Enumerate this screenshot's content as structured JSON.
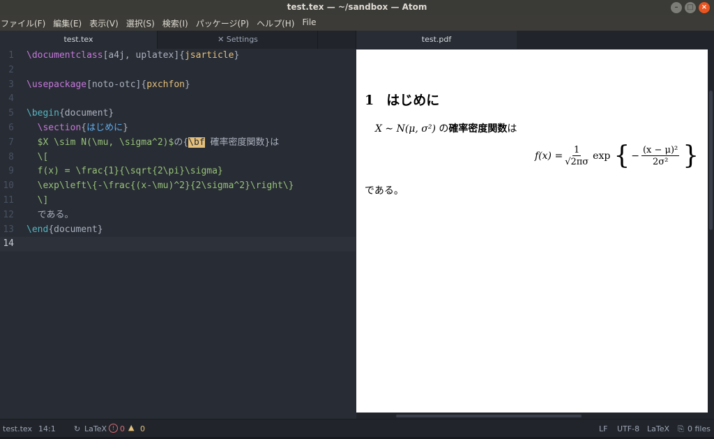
{
  "window": {
    "title": "test.tex — ~/sandbox — Atom"
  },
  "menu": [
    "ファイル(F)",
    "編集(E)",
    "表示(V)",
    "選択(S)",
    "検索(I)",
    "パッケージ(P)",
    "ヘルプ(H)",
    "File"
  ],
  "tabs": {
    "left": [
      {
        "label": "test.tex",
        "icon": ""
      },
      {
        "label": "Settings",
        "icon": "tools-icon"
      }
    ],
    "right": [
      {
        "label": "test.pdf"
      }
    ]
  },
  "editor": {
    "line_numbers": [
      "1",
      "2",
      "3",
      "4",
      "5",
      "6",
      "7",
      "8",
      "9",
      "10",
      "11",
      "12",
      "13",
      "14"
    ],
    "current_line": 14,
    "lines": [
      [
        {
          "t": "\\documentclass",
          "c": "kw"
        },
        {
          "t": "[a4j, uplatex]{",
          "c": ""
        },
        {
          "t": "jsarticle",
          "c": "yl"
        },
        {
          "t": "}",
          "c": ""
        }
      ],
      [],
      [
        {
          "t": "\\usepackage",
          "c": "kw"
        },
        {
          "t": "[noto-otc]{",
          "c": ""
        },
        {
          "t": "pxchfon",
          "c": "yl"
        },
        {
          "t": "}",
          "c": ""
        }
      ],
      [],
      [
        {
          "t": "\\begin",
          "c": "cy"
        },
        {
          "t": "{document}",
          "c": ""
        }
      ],
      [
        {
          "t": "  ",
          "c": ""
        },
        {
          "t": "\\section",
          "c": "kw"
        },
        {
          "t": "{",
          "c": ""
        },
        {
          "t": "はじめに",
          "c": "bl"
        },
        {
          "t": "}",
          "c": ""
        }
      ],
      [
        {
          "t": "  ",
          "c": ""
        },
        {
          "t": "$X \\sim N(\\mu, \\sigma^2)$",
          "c": "gn"
        },
        {
          "t": "の{",
          "c": ""
        },
        {
          "t": "\\bf",
          "c": "hl"
        },
        {
          "t": " 確率密度関数}は",
          "c": ""
        }
      ],
      [
        {
          "t": "  ",
          "c": ""
        },
        {
          "t": "\\[",
          "c": "gn"
        }
      ],
      [
        {
          "t": "  ",
          "c": ""
        },
        {
          "t": "f(x) = \\frac{1}{\\sqrt{2\\pi}\\sigma}",
          "c": "gn"
        }
      ],
      [
        {
          "t": "  ",
          "c": ""
        },
        {
          "t": "\\exp\\left\\{-\\frac{(x-\\mu)^2}{2\\sigma^2}\\right\\}",
          "c": "gn"
        }
      ],
      [
        {
          "t": "  ",
          "c": ""
        },
        {
          "t": "\\]",
          "c": "gn"
        }
      ],
      [
        {
          "t": "  である。",
          "c": ""
        }
      ],
      [
        {
          "t": "\\end",
          "c": "cy"
        },
        {
          "t": "{document}",
          "c": ""
        }
      ],
      []
    ]
  },
  "preview": {
    "section_number": "1",
    "section_title": "はじめに",
    "para1_math": "X ∼ N(μ, σ²)",
    "para1_mid": " の",
    "para1_bold": "確率密度関数",
    "para1_end": "は",
    "eq_lhs": "f(x) =",
    "eq_frac1_num": "1",
    "eq_frac1_den": "√2πσ",
    "eq_exp": "exp",
    "eq_minus": "−",
    "eq_frac2_num": "(x − μ)²",
    "eq_frac2_den": "2σ²",
    "eq_lbrace": "{",
    "eq_rbrace": "}",
    "para2": "である。"
  },
  "status": {
    "file": "test.tex",
    "cursor": "14:1",
    "grammar_tool": "LaTeX",
    "errors": "0",
    "warnings": "0",
    "line_ending": "LF",
    "encoding": "UTF-8",
    "grammar": "LaTeX",
    "git_files": "0 files"
  },
  "colors": {
    "editor_bg": "#282c34",
    "keyword": "#c678dd",
    "string": "#98c379",
    "error": "#e06c75",
    "warning": "#e5c07b"
  }
}
